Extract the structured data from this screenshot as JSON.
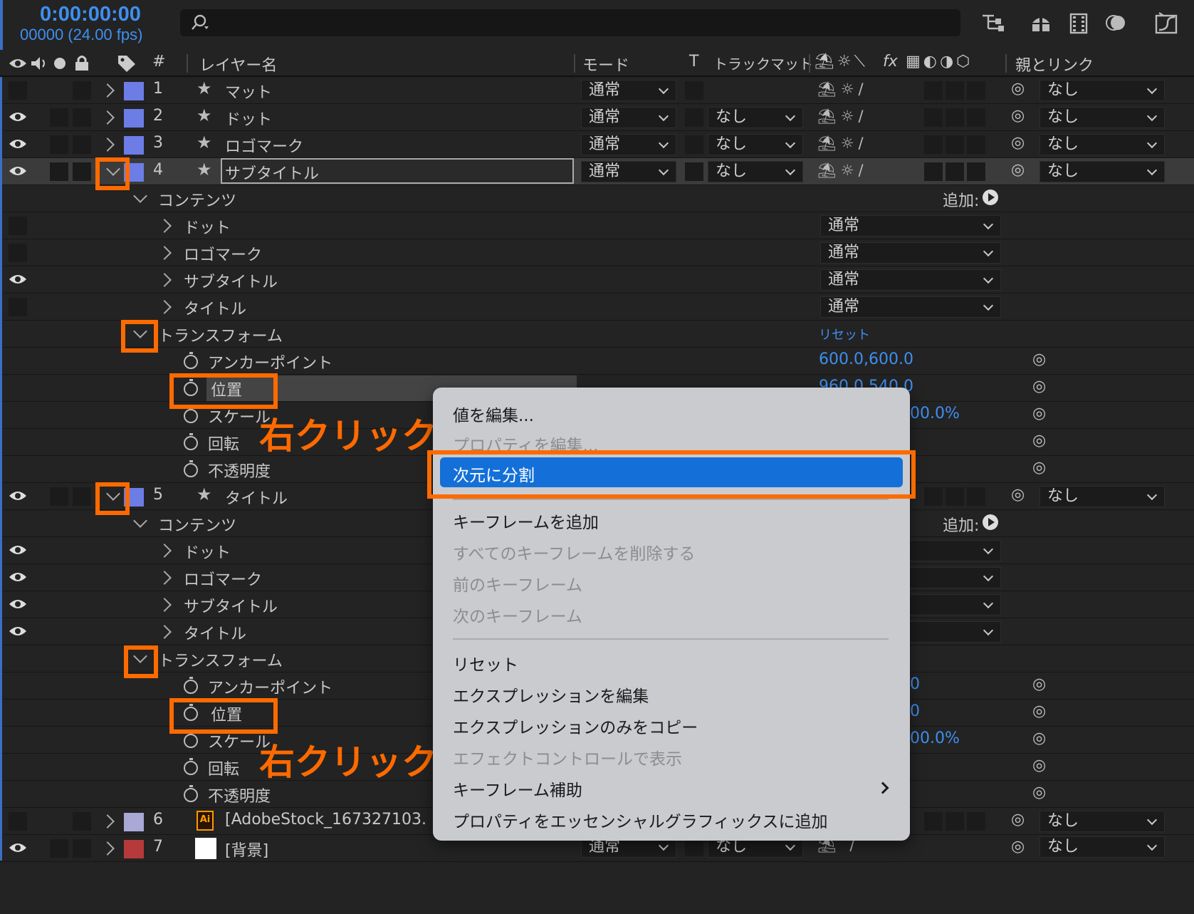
{
  "timeline": {
    "timecode": "0:00:00:00",
    "frames": "00000 (24.00 fps)",
    "search_placeholder": ""
  },
  "header": {
    "hash": "#",
    "layer_name": "レイヤー名",
    "mode": "モード",
    "t": "T",
    "track_matte": "トラックマット",
    "fx": "fx",
    "parent": "親とリンク"
  },
  "layers": [
    {
      "num": "1",
      "name": "マット",
      "mode": "通常",
      "matte": "",
      "parent": "なし",
      "color": "#6c7de6"
    },
    {
      "num": "2",
      "name": "ドット",
      "mode": "通常",
      "matte": "なし",
      "parent": "なし",
      "color": "#6c7de6"
    },
    {
      "num": "3",
      "name": "ロゴマーク",
      "mode": "通常",
      "matte": "なし",
      "parent": "なし",
      "color": "#6c7de6"
    },
    {
      "num": "4",
      "name": "サブタイトル",
      "mode": "通常",
      "matte": "なし",
      "parent": "なし",
      "color": "#6c7de6"
    },
    {
      "num": "5",
      "name": "タイトル",
      "parent": "なし",
      "color": "#6c7de6"
    },
    {
      "num": "6",
      "name": "[AdobeStock_167327103.",
      "parent": "なし",
      "color": "#a8a9d6"
    },
    {
      "num": "7",
      "name": "[背景]",
      "mode": "通常",
      "matte": "なし",
      "parent": "なし",
      "color": "#b63a3a"
    }
  ],
  "layer4": {
    "contents": "コンテンツ",
    "add_label": "追加:",
    "sub_items": [
      {
        "name": "ドット",
        "mode": "通常"
      },
      {
        "name": "ロゴマーク",
        "mode": "通常"
      },
      {
        "name": "サブタイトル",
        "mode": "通常"
      },
      {
        "name": "タイトル",
        "mode": "通常"
      }
    ],
    "transform": "トランスフォーム",
    "reset": "リセット",
    "props": [
      {
        "name": "アンカーポイント",
        "value": "600.0,600.0"
      },
      {
        "name": "位置",
        "value": "960.0,540.0"
      },
      {
        "name": "スケール",
        "value": "00.0%"
      },
      {
        "name": "回転",
        "value": ""
      },
      {
        "name": "不透明度",
        "value": ""
      }
    ]
  },
  "layer5": {
    "contents": "コンテンツ",
    "add_label": "追加:",
    "sub_items": [
      "ドット",
      "ロゴマーク",
      "サブタイトル",
      "タイトル"
    ],
    "transform": "トランスフォーム",
    "props": [
      {
        "name": "アンカーポイント",
        "value": "0"
      },
      {
        "name": "位置",
        "value": "0"
      },
      {
        "name": "スケール",
        "value": "00.0%"
      },
      {
        "name": "回転",
        "value": ""
      },
      {
        "name": "不透明度",
        "value": ""
      }
    ]
  },
  "annotations": {
    "right_click_1": "右クリック",
    "right_click_2": "右クリック"
  },
  "context_menu": {
    "items": [
      {
        "label": "値を編集...",
        "enabled": true
      },
      {
        "label": "プロパティを編集...",
        "enabled": false
      },
      {
        "label": "次元に分割",
        "enabled": true,
        "highlighted": true
      },
      {
        "label": "キーフレームを追加",
        "enabled": true
      },
      {
        "label": "すべてのキーフレームを削除する",
        "enabled": false
      },
      {
        "label": "前のキーフレーム",
        "enabled": false
      },
      {
        "label": "次のキーフレーム",
        "enabled": false
      },
      {
        "label": "リセット",
        "enabled": true
      },
      {
        "label": "エクスプレッションを編集",
        "enabled": true
      },
      {
        "label": "エクスプレッションのみをコピー",
        "enabled": true
      },
      {
        "label": "エフェクトコントロールで表示",
        "enabled": false
      },
      {
        "label": "キーフレーム補助",
        "enabled": true,
        "submenu": true
      },
      {
        "label": "プロパティをエッセンシャルグラフィックスに追加",
        "enabled": true
      }
    ]
  },
  "colors": {
    "accent": "#3e8ff0",
    "highlight": "#ff6a00",
    "menu_selection": "#1470d8"
  }
}
